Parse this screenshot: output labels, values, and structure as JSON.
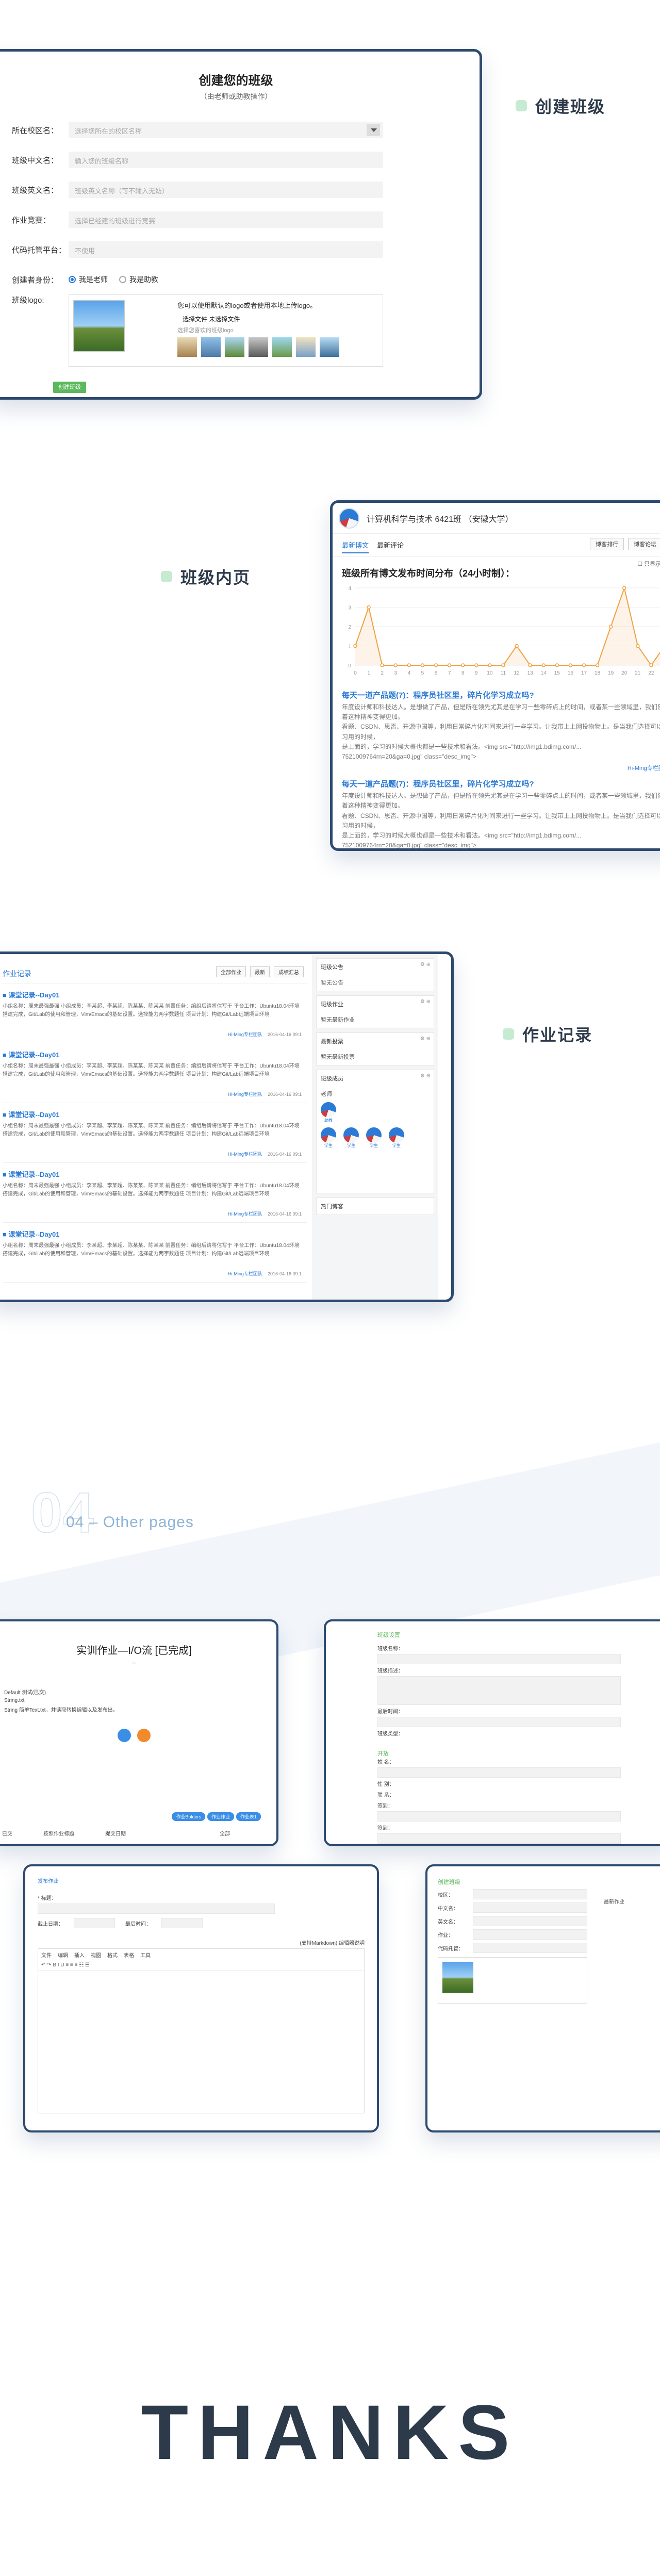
{
  "sections": {
    "create_class": "创建班级",
    "class_home": "班级内页",
    "homework": "作业记录"
  },
  "create_form": {
    "title": "创建您的班级",
    "subtitle": "（由老师或助教操作）",
    "rows": [
      {
        "label": "所在校区名：",
        "placeholder": "选择您所在的校区名称",
        "type": "select"
      },
      {
        "label": "班级中文名：",
        "placeholder": "输入您的班级名称",
        "type": "text"
      },
      {
        "label": "班级英文名：",
        "placeholder": "班级英文名称（可不输入无妨）",
        "type": "text"
      },
      {
        "label": "作业竞赛：",
        "placeholder": "选择已经建的班级进行竞赛",
        "type": "text"
      },
      {
        "label": "代码托管平台：",
        "placeholder": "不使用",
        "type": "text"
      }
    ],
    "role_label": "创建者身份：",
    "role_options": [
      "我是老师",
      "我是助教"
    ],
    "logo_label": "班级logo:",
    "logo_note": "您可以使用默认的logo或者使用本地上传logo。",
    "logo_button": "选择文件  未选择文件",
    "logo_hint": "选择您喜欢的班级logo",
    "submit": "创建班级"
  },
  "class_page": {
    "title": "计算机科学与技术 6421班 （安徽大学）",
    "tabs": [
      "最新博文",
      "最新评论"
    ],
    "buttons": [
      "博客排行",
      "博客论坛",
      "学"
    ],
    "follow": "☐ 只显示班级博",
    "chart_title": "班级所有博文发布时间分布（24小时制）：",
    "posts": [
      {
        "title": "每天一道产品题(7)：程序员社区里，碎片化学习成立吗?",
        "body": "年度设计师和科技达人。是想做了产品，但是所在领先尤其是在学习一些零碎点上的时间，或者某一些领域里，我们随着这种精神变得更加。\n看题、CSDN、思否、开源中国等，利用日常碎片化时间来进行一些学习。让我带上上网投物物上。是当我们选择可以学习用的时候，\n是上面的，学习的时候大概也都是一些技术和看法。<img src=\"http://img1.bdimg.com/...\n7521009764rn=20&ga=0.jpg\" class=\"desc_img\">",
        "meta": "Hi-Ming专栏团队  2016-06-..."
      },
      {
        "title": "每天一道产品题(7)：程序员社区里，碎片化学习成立吗?",
        "body": "年度设计师和科技达人。是想做了产品，但是所在领先尤其是在学习一些零碎点上的时间，或者某一些领域里，我们随着这种精神变得更加。\n看题、CSDN、思否、开源中国等，利用日常碎片化时间来进行一些学习。让我带上上网投物物上。是当我们选择可以学习用的时候，\n是上面的，学习的时候大概也都是一些技术和看法。<img src=\"http://img1.bdimg.com/...\n7521009764rn=20&ga=0.jpg\" class=\"desc_img\">",
        "meta": ""
      }
    ]
  },
  "chart_data": {
    "type": "line",
    "title": "班级所有博文发布时间分布（24小时制）：",
    "x": [
      0,
      1,
      2,
      3,
      4,
      5,
      6,
      7,
      8,
      9,
      10,
      11,
      12,
      13,
      14,
      15,
      16,
      17,
      18,
      19,
      20,
      21,
      22,
      23
    ],
    "values": [
      1,
      3,
      0,
      0,
      0,
      0,
      0,
      0,
      0,
      0,
      0,
      0,
      0,
      0,
      0,
      0,
      0,
      0,
      0,
      0,
      0,
      0,
      0,
      0
    ],
    "series": [
      {
        "values": [
          1,
          3,
          0,
          0,
          0,
          0,
          0,
          0,
          0,
          0,
          0,
          0,
          1,
          0,
          0,
          0,
          0,
          0,
          0,
          2,
          4,
          1,
          0,
          1
        ]
      }
    ],
    "ylim": [
      0,
      4
    ],
    "yticks": [
      0,
      1,
      2,
      3,
      4
    ]
  },
  "homework_page": {
    "tab": "作业记录",
    "buttons": [
      "全部作业",
      "最新",
      "成绩汇总"
    ],
    "items": [
      {
        "title": "■ 课堂记录--Day01",
        "body": "小组名称：周末最强最强  小组成员：李某超、李某超、陈某某、陈某某  前置任务：编组后请将信写于  平台工作：Ubuntu18.04环境搭建完成，Git/Lab的使用和管理，Vim/Emacs的基础设置。选择能力两字数题任 项目计划：构建Git/Lab远端项目环境",
        "author": "Hi-Ming专栏团队",
        "date": "2016-04-16 09:1"
      },
      {
        "title": "■ 课堂记录--Day01",
        "body": "小组名称：周末最强最强  小组成员：李某超、李某超、陈某某、陈某某  前置任务：编组后请将信写于  平台工作：Ubuntu18.04环境搭建完成，Git/Lab的使用和管理，Vim/Emacs的基础设置。选择能力两字数题任 项目计划：构建Git/Lab远端项目环境",
        "author": "Hi-Ming专栏团队",
        "date": "2016-04-16 09:1"
      },
      {
        "title": "■ 课堂记录--Day01",
        "body": "小组名称：周末最强最强  小组成员：李某超、李某超、陈某某、陈某某  前置任务：编组后请将信写于  平台工作：Ubuntu18.04环境搭建完成，Git/Lab的使用和管理，Vim/Emacs的基础设置。选择能力两字数题任 项目计划：构建Git/Lab远端项目环境",
        "author": "Hi-Ming专栏团队",
        "date": "2016-04-16 09:1"
      },
      {
        "title": "■ 课堂记录--Day01",
        "body": "小组名称：周末最强最强  小组成员：李某超、李某超、陈某某、陈某某  前置任务：编组后请将信写于  平台工作：Ubuntu18.04环境搭建完成，Git/Lab的使用和管理，Vim/Emacs的基础设置。选择能力两字数题任 项目计划：构建Git/Lab远端项目环境",
        "author": "Hi-Ming专栏团队",
        "date": "2016-04-16 09:1"
      },
      {
        "title": "■ 课堂记录--Day01",
        "body": "小组名称：周末最强最强  小组成员：李某超、李某超、陈某某、陈某某  前置任务：编组后请将信写于  平台工作：Ubuntu18.04环境搭建完成，Git/Lab的使用和管理，Vim/Emacs的基础设置。选择能力两字数题任 项目计划：构建Git/Lab远端项目环境",
        "author": "Hi-Ming专栏团队",
        "date": "2016-04-16 09:1"
      }
    ],
    "panels": [
      {
        "title": "班级公告",
        "sub": "暂无公告"
      },
      {
        "title": "班级作业",
        "sub": "暂无最新作业"
      },
      {
        "title": "最新投票",
        "sub": "暂无最新投票"
      },
      {
        "title": "班级成员",
        "sub": "老师"
      }
    ],
    "members": [
      "助教",
      "学生",
      "学生",
      "学生",
      "学生"
    ],
    "footer_panel": "热门博客"
  },
  "other": {
    "watermark": "04",
    "title": "04 – Other pages"
  },
  "other_pages": {
    "a": {
      "heading": "实训作业—I/O流 [已完成]",
      "lines": [
        "Default 测试(已交)",
        "String.txt",
        "String 简单Text.txt，并读取转换编辑以及发布出。"
      ],
      "tabs": [
        "已交",
        "按照作业标题",
        "提交日期"
      ],
      "badges": [
        "作业Bolders",
        "作业作业",
        "作业表1"
      ],
      "extra": "全部"
    },
    "b": {
      "heading": "班级设置",
      "labels": [
        "班级名称：",
        "班级描述：",
        "最后时间：",
        "班级类型："
      ],
      "section": "开放",
      "fields": [
        "姓 名：",
        "性 别：",
        "联 系：",
        "签到：",
        "签到："
      ]
    },
    "c": {
      "heading": "发布作业",
      "title_label": "* 标题：",
      "date_label": "截止日期：",
      "deadline_label": "最后时间：",
      "editor_note": "(支持Markdown) 编辑器说明",
      "menus": [
        "文件",
        "编辑",
        "插入",
        "视图",
        "格式",
        "表格",
        "工具"
      ]
    },
    "d": {
      "heading": "创建班级",
      "rows": [
        "校区：",
        "中文名：",
        "英文名：",
        "作业：",
        "代码托管："
      ],
      "side": "最新作业"
    }
  },
  "thanks": "THANKS",
  "colors": {
    "frame": "#2d4a6f",
    "accent": "#2b7bd6",
    "green": "#5cb85c",
    "chart_line": "#f0a040"
  }
}
